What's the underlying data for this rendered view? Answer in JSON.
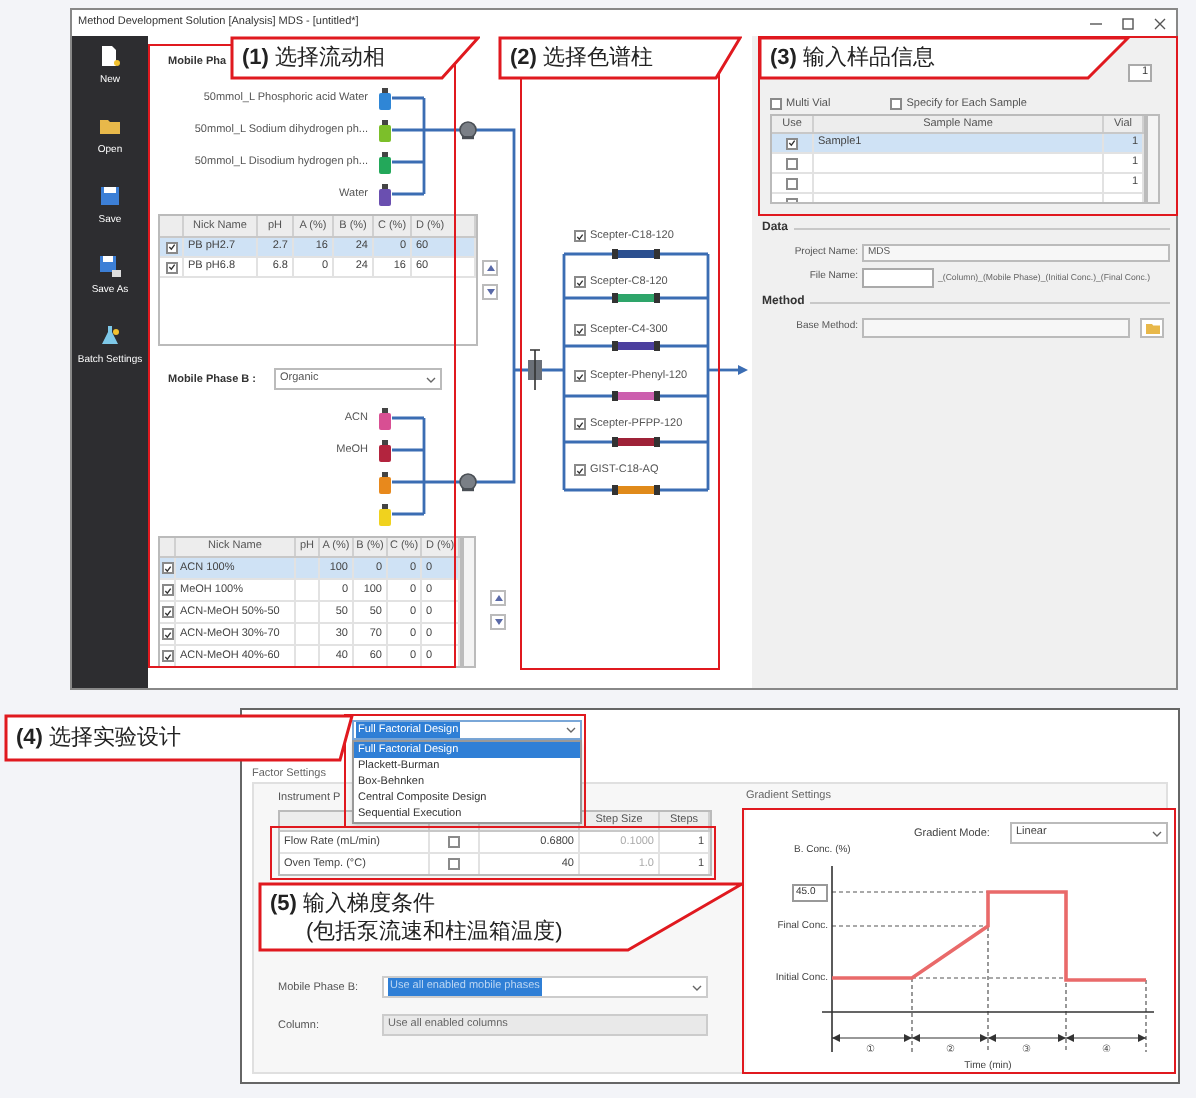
{
  "window": {
    "title": "Method Development Solution [Analysis] MDS - [untitled*]"
  },
  "sidebar": {
    "items": [
      {
        "label": "New",
        "kind": "new"
      },
      {
        "label": "Open",
        "kind": "open"
      },
      {
        "label": "Save",
        "kind": "save"
      },
      {
        "label": "Save As",
        "kind": "save_as"
      },
      {
        "label": "Batch Settings",
        "kind": "batch"
      }
    ]
  },
  "mobile_phase_a": {
    "label": "Mobile Pha",
    "bottles": [
      {
        "label": "50mmol_L Phosphoric acid Water",
        "color": "#2f86d6"
      },
      {
        "label": "50mmol_L Sodium dihydrogen ph...",
        "color": "#7cbf2a"
      },
      {
        "label": "50mmol_L Disodium hydrogen ph...",
        "color": "#23a85a"
      },
      {
        "label": "Water",
        "color": "#6a4fb0"
      }
    ],
    "table": {
      "columns": [
        "Nick Name",
        "pH",
        "A (%)",
        "B (%)",
        "C (%)",
        "D (%)"
      ],
      "rows": [
        {
          "checked": true,
          "selected": true,
          "nick_name": "PB pH2.7",
          "ph": "2.7",
          "a": "16",
          "b": "24",
          "c": "0",
          "d": "60"
        },
        {
          "checked": true,
          "selected": false,
          "nick_name": "PB pH6.8",
          "ph": "6.8",
          "a": "0",
          "b": "24",
          "c": "16",
          "d": "60"
        }
      ]
    }
  },
  "mobile_phase_b": {
    "label": "Mobile Phase B :",
    "dropdown": "Organic",
    "bottles": [
      {
        "label": "ACN",
        "color": "#d84f93"
      },
      {
        "label": "MeOH",
        "color": "#b3243e"
      },
      {
        "color": "#e8891c"
      },
      {
        "color": "#f0d21e"
      }
    ],
    "table": {
      "columns": [
        "Nick Name",
        "pH",
        "A (%)",
        "B (%)",
        "C (%)",
        "D (%)"
      ],
      "rows": [
        {
          "checked": true,
          "selected": true,
          "nick_name": "ACN 100%",
          "a": "100",
          "b": "0",
          "c": "0",
          "d": "0"
        },
        {
          "checked": true,
          "selected": false,
          "nick_name": "MeOH 100%",
          "a": "0",
          "b": "100",
          "c": "0",
          "d": "0"
        },
        {
          "checked": true,
          "selected": false,
          "nick_name": "ACN-MeOH 50%-50",
          "a": "50",
          "b": "50",
          "c": "0",
          "d": "0"
        },
        {
          "checked": true,
          "selected": false,
          "nick_name": "ACN-MeOH 30%-70",
          "a": "30",
          "b": "70",
          "c": "0",
          "d": "0"
        },
        {
          "checked": true,
          "selected": false,
          "nick_name": "ACN-MeOH 40%-60",
          "a": "40",
          "b": "60",
          "c": "0",
          "d": "0"
        }
      ]
    }
  },
  "columns_panel": {
    "columns": [
      {
        "label": "Scepter-C18-120",
        "checked": true,
        "color": "#2b4f8f"
      },
      {
        "label": "Scepter-C8-120",
        "checked": true,
        "color": "#2ea56a"
      },
      {
        "label": "Scepter-C4-300",
        "checked": true,
        "color": "#4b3f9e"
      },
      {
        "label": "Scepter-Phenyl-120",
        "checked": true,
        "color": "#cc5fae"
      },
      {
        "label": "Scepter-PFPP-120",
        "checked": true,
        "color": "#9e2238"
      },
      {
        "label": "GIST-C18-AQ",
        "checked": true,
        "color": "#e08a1a"
      }
    ]
  },
  "sample_panel": {
    "count": "1",
    "multi_vial": {
      "label": "Multi Vial",
      "checked": false
    },
    "specify_each": {
      "label": "Specify for Each Sample",
      "checked": false
    },
    "table": {
      "columns": [
        "Use",
        "Sample Name",
        "Vial"
      ],
      "rows": [
        {
          "checked": true,
          "selected": true,
          "name": "Sample1",
          "vial": "1"
        },
        {
          "checked": false,
          "selected": false,
          "vial": "1"
        },
        {
          "checked": false,
          "selected": false,
          "vial": "1"
        },
        {
          "checked": false,
          "selected": false
        }
      ]
    }
  },
  "data_section": {
    "title": "Data",
    "project_name": {
      "label": "Project Name:",
      "value": "MDS"
    },
    "file_name": {
      "label": "File Name:",
      "suffix": "_(Column)_(Mobile Phase)_(Initial Conc.)_(Final Conc.)"
    }
  },
  "method_section": {
    "title": "Method",
    "base_method": {
      "label": "Base Method:"
    }
  },
  "design_window": {
    "design_dropdown": {
      "value": "Full Factorial Design",
      "options": [
        {
          "label": "Full Factorial Design",
          "selected": true
        },
        {
          "label": "Plackett-Burman",
          "selected": false
        },
        {
          "label": "Box-Behnken",
          "selected": false
        },
        {
          "label": "Central Composite Design",
          "selected": false
        },
        {
          "label": "Sequential Execution",
          "selected": false
        }
      ]
    },
    "factor_settings": {
      "title": "Factor Settings",
      "instrument_label": "Instrument P",
      "table": {
        "columns": [
          "Step Size",
          "Steps"
        ],
        "rows": [
          {
            "parameter": "Flow Rate (mL/min)",
            "checked": false,
            "value": "0.6800",
            "step_size": "0.1000",
            "steps": "1"
          },
          {
            "parameter": "Oven Temp. (°C)",
            "checked": false,
            "value": "40",
            "step_size": "1.0",
            "steps": "1"
          }
        ]
      },
      "mobile_phase_b": {
        "label": "Mobile Phase B:",
        "value": "Use all enabled mobile phases"
      },
      "column": {
        "label": "Column:",
        "value": "Use all enabled columns"
      }
    },
    "gradient_settings": {
      "title": "Gradient Settings",
      "mode": {
        "label": "Gradient Mode:",
        "value": "Linear"
      },
      "y_label": "B. Conc. (%)",
      "max_value": "45.0",
      "final_label": "Final Conc.",
      "initial_label": "Initial Conc.",
      "segments": [
        "①",
        "②",
        "③",
        "④"
      ],
      "x_label": "Time (min)"
    }
  },
  "callouts": [
    {
      "lines": [
        "**(1)** 选择流动相"
      ]
    },
    {
      "lines": [
        "**(2)** 选择色谱柱"
      ]
    },
    {
      "lines": [
        "**(3)** 输入样品信息"
      ]
    },
    {
      "lines": [
        "**(4)** 选择实验设计"
      ]
    },
    {
      "lines": [
        "**(5)** 输入梯度条件",
        "(包括泵流速和柱温箱温度)"
      ]
    }
  ]
}
